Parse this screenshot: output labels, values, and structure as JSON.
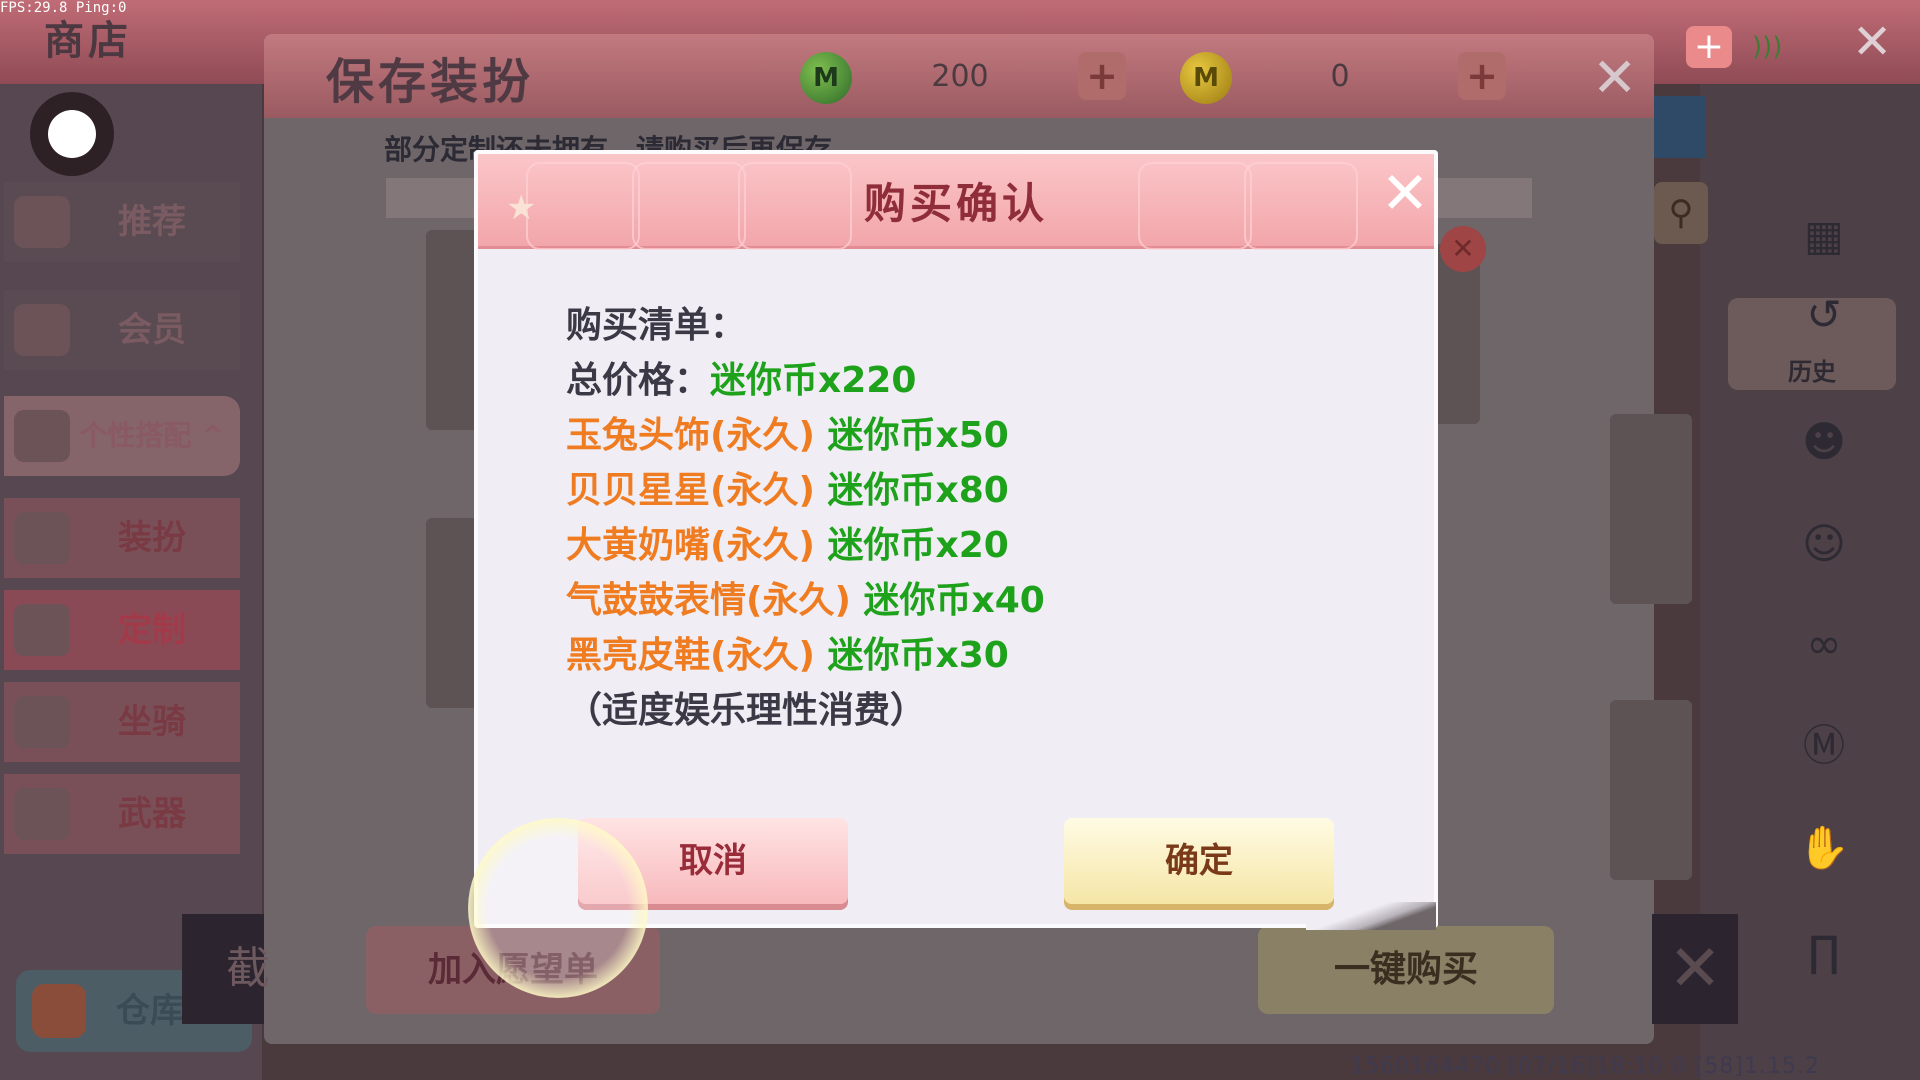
{
  "status": {
    "fps_text": "FPS:29.8  Ping:0",
    "bottom_info": "1560164470   [07/16]18:10 0   [58]1.15.2"
  },
  "shop": {
    "title": "商店"
  },
  "sidebar": {
    "items": [
      {
        "label": "推荐"
      },
      {
        "label": "会员"
      },
      {
        "label": "个性搭配"
      },
      {
        "label": "装扮"
      },
      {
        "label": "定制"
      },
      {
        "label": "坐骑"
      },
      {
        "label": "武器"
      }
    ],
    "expand_arrow": "^",
    "warehouse": "仓库"
  },
  "right_sidebar": {
    "history_label": "历史"
  },
  "save_panel": {
    "title": "保存装扮",
    "notice": "部分定制还未拥有，请购买后再保存",
    "green_coin_value": "200",
    "gold_coin_value": "0",
    "green_coin_icon": "M",
    "gold_coin_icon": "M",
    "wishlist_button": "加入愿望单",
    "buy_all_button": "一键购买",
    "capture_label": "截"
  },
  "modal": {
    "title": "购买确认",
    "list_heading": "购买清单：",
    "total_label": "总价格：",
    "total_value": "迷你币x220",
    "items": [
      {
        "name": "玉兔头饰(永久)",
        "price": "迷你币x50"
      },
      {
        "name": "贝贝星星(永久)",
        "price": "迷你币x80"
      },
      {
        "name": "大黄奶嘴(永久)",
        "price": "迷你币x20"
      },
      {
        "name": "气鼓鼓表情(永久)",
        "price": "迷你币x40"
      },
      {
        "name": "黑亮皮鞋(永久)",
        "price": "迷你币x30"
      }
    ],
    "disclaimer": "（适度娱乐理性消费）",
    "cancel_button": "取消",
    "confirm_button": "确定"
  },
  "colors": {
    "item_name": "#f07c22",
    "price": "#1ea21b",
    "title": "#8f2d3a",
    "header_pink": "#f2a6ab"
  }
}
